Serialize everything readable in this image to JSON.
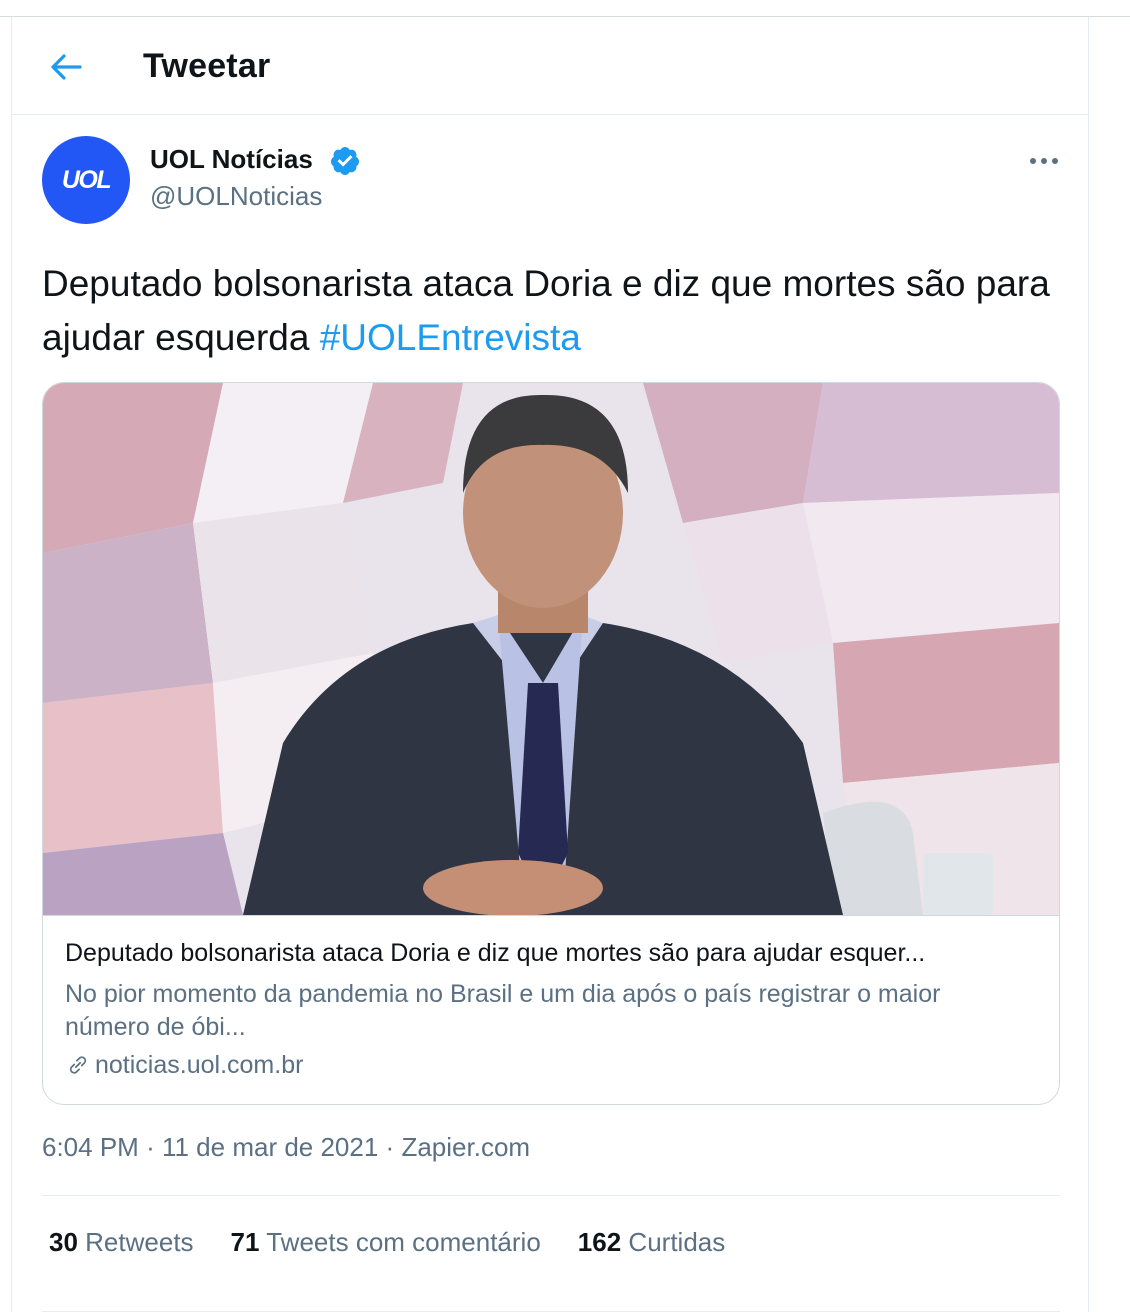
{
  "header": {
    "title": "Tweetar",
    "back_icon": "arrow-left-icon"
  },
  "tweet": {
    "author": {
      "name": "UOL Notícias",
      "handle": "@UOLNoticias",
      "avatar_text": "UOL",
      "avatar_color": "#2357f5",
      "verified": true
    },
    "text": "Deputado bolsonarista ataca Doria e diz que mortes são para ajudar esquerda",
    "hashtag": "#UOLEntrevista",
    "card": {
      "title": "Deputado bolsonarista ataca Doria e diz que mortes são para ajudar esquer...",
      "description": "No pior momento da pandemia no Brasil e um dia após o país registrar o maior número de óbi...",
      "domain": "noticias.uol.com.br",
      "link_icon": "link-icon"
    },
    "meta": {
      "time": "6:04 PM",
      "separator": "·",
      "date": "11 de mar de 2021",
      "source": "Zapier.com"
    },
    "stats": {
      "retweets": {
        "count": "30",
        "label": "Retweets"
      },
      "quotes": {
        "count": "71",
        "label": "Tweets com comentário"
      },
      "likes": {
        "count": "162",
        "label": "Curtidas"
      }
    }
  },
  "colors": {
    "accent": "#1d9bf0",
    "secondary_text": "#5b7083",
    "primary_text": "#0f1419"
  }
}
